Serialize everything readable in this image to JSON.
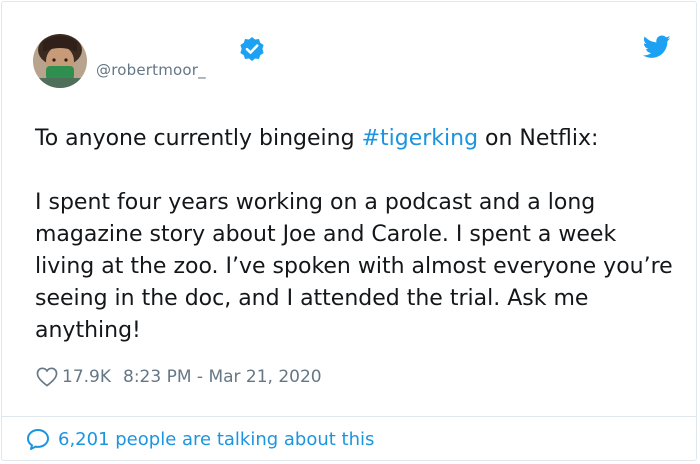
{
  "tweet": {
    "username": "@robertmoor_",
    "text_line1_before": "To anyone currently bingeing ",
    "hashtag": "#tigerking",
    "text_line1_after": " on Netflix:",
    "text_para2": "I spent four years working on a podcast and a long magazine story about Joe and Carole. I spent a week living at the zoo. I’ve spoken with almost everyone you’re seeing in the doc, and I attended the trial. Ask me anything!",
    "likes": "17.9K",
    "timestamp": "8:23 PM - Mar 21, 2020"
  },
  "footer": {
    "talking_label": "6,201 people are talking about this"
  },
  "colors": {
    "accent": "#1b95e0",
    "muted": "#657786",
    "text": "#14171a",
    "border": "#e1e8ed"
  },
  "icons": {
    "verified": "verified-badge-icon",
    "brand": "twitter-bird-icon",
    "like": "heart-icon",
    "reply": "speech-bubble-icon"
  }
}
